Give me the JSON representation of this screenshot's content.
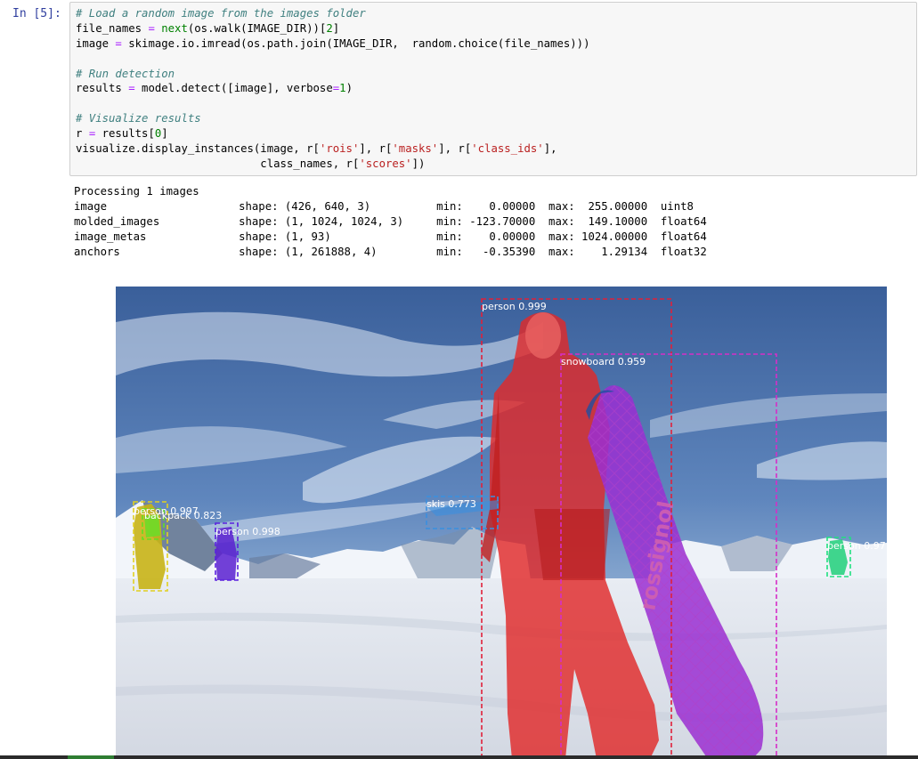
{
  "cell": {
    "prompt": "In  [5]:",
    "code": [
      [
        {
          "t": "# Load a random image from the images folder",
          "c": "cm"
        }
      ],
      [
        {
          "t": "file_names "
        },
        {
          "t": "=",
          "c": "op"
        },
        {
          "t": " "
        },
        {
          "t": "next",
          "c": "kw"
        },
        {
          "t": "(os.walk(IMAGE_DIR))["
        },
        {
          "t": "2",
          "c": "nu"
        },
        {
          "t": "]"
        }
      ],
      [
        {
          "t": "image "
        },
        {
          "t": "=",
          "c": "op"
        },
        {
          "t": " skimage.io.imread(os.path.join(IMAGE_DIR,  random.choice(file_names)))"
        }
      ],
      [
        {
          "t": ""
        }
      ],
      [
        {
          "t": "# Run detection",
          "c": "cm"
        }
      ],
      [
        {
          "t": "results "
        },
        {
          "t": "=",
          "c": "op"
        },
        {
          "t": " model.detect([image], verbose"
        },
        {
          "t": "=",
          "c": "op"
        },
        {
          "t": "1",
          "c": "nu"
        },
        {
          "t": ")"
        }
      ],
      [
        {
          "t": ""
        }
      ],
      [
        {
          "t": "# Visualize results",
          "c": "cm"
        }
      ],
      [
        {
          "t": "r "
        },
        {
          "t": "=",
          "c": "op"
        },
        {
          "t": " results["
        },
        {
          "t": "0",
          "c": "nu"
        },
        {
          "t": "]"
        }
      ],
      [
        {
          "t": "visualize.display_instances(image, r["
        },
        {
          "t": "'rois'",
          "c": "st"
        },
        {
          "t": "], r["
        },
        {
          "t": "'masks'",
          "c": "st"
        },
        {
          "t": "], r["
        },
        {
          "t": "'class_ids'",
          "c": "st"
        },
        {
          "t": "],"
        }
      ],
      [
        {
          "t": "                            class_names, r["
        },
        {
          "t": "'scores'",
          "c": "st"
        },
        {
          "t": "])"
        }
      ]
    ]
  },
  "output": [
    "Processing 1 images",
    "image                    shape: (426, 640, 3)          min:    0.00000  max:  255.00000  uint8",
    "molded_images            shape: (1, 1024, 1024, 3)     min: -123.70000  max:  149.10000  float64",
    "image_metas              shape: (1, 93)                min:    0.00000  max: 1024.00000  float64",
    "anchors                  shape: (1, 261888, 4)         min:   -0.35390  max:    1.29134  float32"
  ],
  "detections": [
    {
      "label": "person 0.999",
      "color": "#e0203a"
    },
    {
      "label": "snowboard 0.959",
      "color": "#d62ec8"
    },
    {
      "label": "skis 0.773",
      "color": "#3a8fe0"
    },
    {
      "label": "person 0.997",
      "color": "#e0d020"
    },
    {
      "label": "backpack 0.823",
      "color": "#62e020"
    },
    {
      "label": "person 0.998",
      "color": "#5a20e0"
    },
    {
      "label": "person 0.97",
      "color": "#20e080"
    }
  ]
}
